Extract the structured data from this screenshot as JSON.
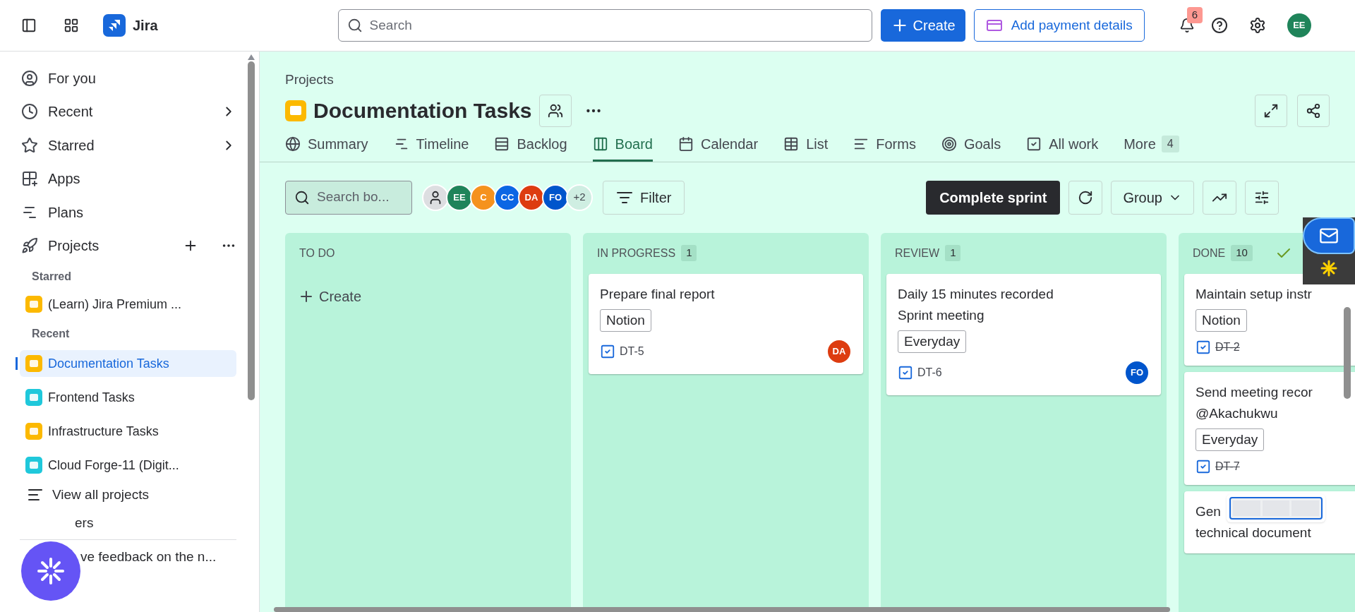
{
  "topbar": {
    "product": "Jira",
    "search": {
      "placeholder": "Search"
    },
    "create": "Create",
    "payment": "Add payment details",
    "notifications": "6",
    "avatar": "EE"
  },
  "sidebar": {
    "nav": [
      {
        "label": "For you",
        "kind": "link"
      },
      {
        "label": "Recent",
        "kind": "submenu"
      },
      {
        "label": "Starred",
        "kind": "submenu"
      },
      {
        "label": "Apps",
        "kind": "link"
      },
      {
        "label": "Plans",
        "kind": "link"
      },
      {
        "label": "Projects",
        "kind": "section"
      }
    ],
    "starred_heading": "Starred",
    "starred": [
      {
        "label": "(Learn) Jira Premium ...",
        "color": "#fcb900",
        "selected": false
      }
    ],
    "recent_heading": "Recent",
    "recent": [
      {
        "label": "Documentation Tasks",
        "color": "#fcb900",
        "selected": true
      },
      {
        "label": "Frontend Tasks",
        "color": "#1fc8db",
        "selected": false
      },
      {
        "label": "Infrastructure Tasks",
        "color": "#fcb900",
        "selected": false
      },
      {
        "label": "Cloud Forge-11 (Digit...",
        "color": "#1fc8db",
        "selected": false
      }
    ],
    "view_all": "View all projects",
    "filters": "ers",
    "feedback": "ve feedback on the n..."
  },
  "header": {
    "breadcrumb": "Projects",
    "title": "Documentation Tasks",
    "tabs": [
      {
        "label": "Summary",
        "selected": false
      },
      {
        "label": "Timeline",
        "selected": false
      },
      {
        "label": "Backlog",
        "selected": false
      },
      {
        "label": "Board",
        "selected": true
      },
      {
        "label": "Calendar",
        "selected": false
      },
      {
        "label": "List",
        "selected": false
      },
      {
        "label": "Forms",
        "selected": false
      },
      {
        "label": "Goals",
        "selected": false
      },
      {
        "label": "All work",
        "selected": false
      }
    ],
    "more": "More",
    "more_count": "4"
  },
  "toolbar": {
    "search": {
      "placeholder": "Search bo..."
    },
    "avatars": [
      {
        "initials": "EE",
        "color": "#1f845a"
      },
      {
        "initials": "C",
        "color": "#f5921e"
      },
      {
        "initials": "CC",
        "color": "#0c66e4"
      },
      {
        "initials": "DA",
        "color": "#dd3c10"
      },
      {
        "initials": "FO",
        "color": "#0055cc"
      }
    ],
    "more_people": "+2",
    "filter": "Filter",
    "complete": "Complete sprint",
    "group": "Group"
  },
  "columns": [
    {
      "title": "TO DO",
      "done": false,
      "create": "Create"
    },
    {
      "title": "IN PROGRESS",
      "count": "1",
      "done": false,
      "cards": [
        {
          "lines": [
            "Prepare final report"
          ],
          "tag": "Notion",
          "key": "DT-5",
          "resolved": false,
          "assignee": {
            "initials": "DA",
            "color": "#dd3c10"
          }
        }
      ]
    },
    {
      "title": "REVIEW",
      "count": "1",
      "done": false,
      "cards": [
        {
          "lines": [
            "Daily 15 minutes recorded",
            "Sprint meeting"
          ],
          "tag": "Everyday",
          "key": "DT-6",
          "resolved": false,
          "assignee": {
            "initials": "FO",
            "color": "#0055cc"
          }
        }
      ]
    },
    {
      "title": "DONE",
      "count": "10",
      "done": true,
      "cards": [
        {
          "lines": [
            "Maintain setup instr"
          ],
          "tag": "Notion",
          "key": "DT-2",
          "resolved": true
        },
        {
          "lines": [
            "Send meeting recor",
            "@Akachukwu"
          ],
          "tag": "Everyday",
          "key": "DT-7",
          "resolved": true
        },
        {
          "lines": [
            "Gen",
            "technical document"
          ]
        }
      ]
    }
  ]
}
